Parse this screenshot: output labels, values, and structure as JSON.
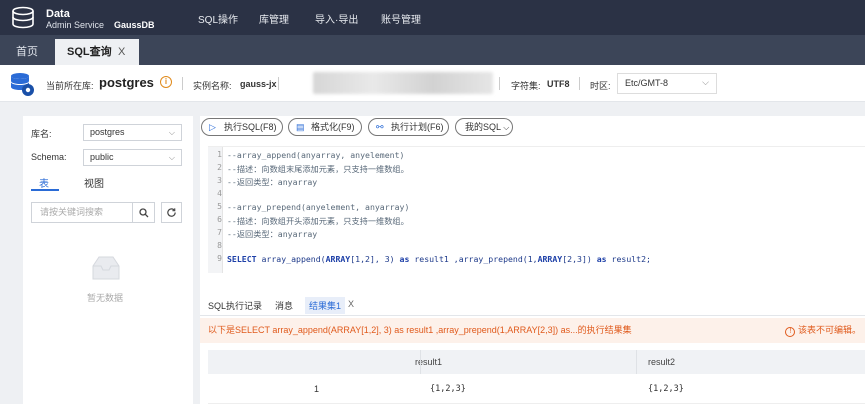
{
  "brand": {
    "line1": "Data",
    "line2": "Admin Service",
    "product": "GaussDB"
  },
  "nav": [
    "SQL操作",
    "库管理",
    "导入·导出",
    "账号管理"
  ],
  "tabs": {
    "home": "首页",
    "sql": "SQL查询",
    "close": "X"
  },
  "info": {
    "current_db_label": "当前所在库:",
    "current_db": "postgres",
    "instance_label": "实例名称:",
    "instance": "gauss-jx",
    "charset_label": "字符集:",
    "charset": "UTF8",
    "timezone_label": "时区:",
    "timezone": "Etc/GMT-8"
  },
  "left": {
    "db_label": "库名:",
    "db_value": "postgres",
    "schema_label": "Schema:",
    "schema_value": "public",
    "subtabs": [
      "表",
      "视图"
    ],
    "search_placeholder": "请按关键词搜索",
    "empty": "暂无数据"
  },
  "toolbar": {
    "run": "执行SQL(F8)",
    "format": "格式化(F9)",
    "plan": "执行计划(F6)",
    "mysql": "我的SQL"
  },
  "code_lines": [
    "--array_append(anyarray, anyelement)",
    "--描述：向数组末尾添加元素，只支持一维数组。",
    "--返回类型：anyarray",
    "",
    "--array_prepend(anyelement, anyarray)",
    "--描述：向数组开头添加元素，只支持一维数组。",
    "--返回类型：anyarray",
    "",
    "SELECT array_append(ARRAY[1,2], 3) as result1 ,array_prepend(1,ARRAY[2,3]) as result2;"
  ],
  "line_numbers": [
    "1",
    "2",
    "3",
    "4",
    "5",
    "6",
    "7",
    "8",
    "9"
  ],
  "result_tabs": [
    "SQL执行记录",
    "消息",
    "结果集1",
    "X"
  ],
  "message": "以下是SELECT array_append(ARRAY[1,2], 3) as result1 ,array_prepend(1,ARRAY[2,3]) as...的执行结果集",
  "readonly": "该表不可编辑。",
  "table": {
    "headers": [
      "",
      "result1",
      "result2"
    ],
    "rows": [
      [
        "1",
        "{1,2,3}",
        "{1,2,3}"
      ]
    ]
  },
  "colors": {
    "nav_bg": "#2b3245",
    "accent": "#2a6bd6",
    "warn": "#e05a1c"
  }
}
